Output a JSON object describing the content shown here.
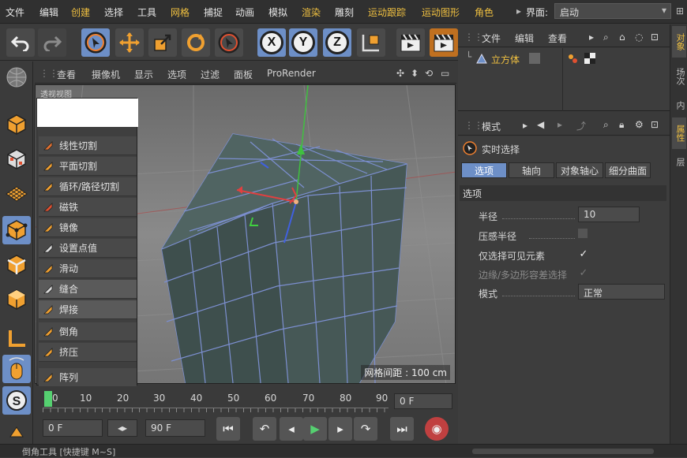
{
  "menubar": {
    "items": [
      "文件",
      "编辑",
      "创建",
      "选择",
      "工具",
      "网格",
      "捕捉",
      "动画",
      "模拟",
      "渲染",
      "雕刻",
      "运动跟踪",
      "运动图形",
      "角色"
    ],
    "layout_label": "界面:",
    "layout_value": "启动"
  },
  "toolbar": {
    "axis_x": "X",
    "axis_y": "Y",
    "axis_z": "Z"
  },
  "viewport": {
    "menu": [
      "查看",
      "摄像机",
      "显示",
      "选项",
      "过滤",
      "面板",
      "ProRender"
    ],
    "label": "透视视图",
    "grid_spacing": "网格间距 : 100 cm"
  },
  "popup": {
    "items": [
      {
        "label": "线性切割",
        "icon": "knife-icon"
      },
      {
        "label": "平面切割",
        "icon": "plane-cut-icon"
      },
      {
        "label": "循环/路径切割",
        "icon": "loop-cut-icon"
      },
      {
        "label": "磁铁",
        "icon": "magnet-icon"
      },
      {
        "label": "镜像",
        "icon": "mirror-icon"
      },
      {
        "label": "设置点值",
        "icon": "set-point-icon"
      },
      {
        "label": "滑动",
        "icon": "slide-icon"
      },
      {
        "label": "缝合",
        "icon": "stitch-icon"
      },
      {
        "label": "焊接",
        "icon": "weld-icon"
      },
      {
        "label": "倒角",
        "icon": "bevel-icon"
      },
      {
        "label": "挤压",
        "icon": "extrude-icon"
      },
      {
        "label": "阵列",
        "icon": "array-icon"
      }
    ]
  },
  "timeline": {
    "ticks": [
      "0",
      "10",
      "20",
      "30",
      "40",
      "50",
      "60",
      "70",
      "80",
      "90"
    ],
    "end_frame": "0 F"
  },
  "transport": {
    "start_field": "0 F",
    "end_field": "90 F"
  },
  "status": {
    "text": "倒角工具 [快捷键 M~S]"
  },
  "object_manager": {
    "menu": [
      "文件",
      "编辑",
      "查看"
    ],
    "object_name": "立方体"
  },
  "attributes": {
    "menu_label": "模式",
    "tool_name": "实时选择",
    "tabs": [
      "选项",
      "轴向",
      "对象轴心",
      "细分曲面"
    ],
    "section": "选项",
    "radius_label": "半径",
    "radius_value": "10",
    "pressure_label": "压感半径",
    "visible_label": "仅选择可见元素",
    "edge_label": "边缘/多边形容差选择",
    "mode_label": "模式",
    "mode_value": "正常"
  },
  "right_tabs": [
    "对象",
    "场次",
    "内",
    "属性",
    "层"
  ],
  "colors": {
    "accent": "#6d8fc7",
    "playhead": "#55d070",
    "menu_yellow": "#f0c040"
  }
}
